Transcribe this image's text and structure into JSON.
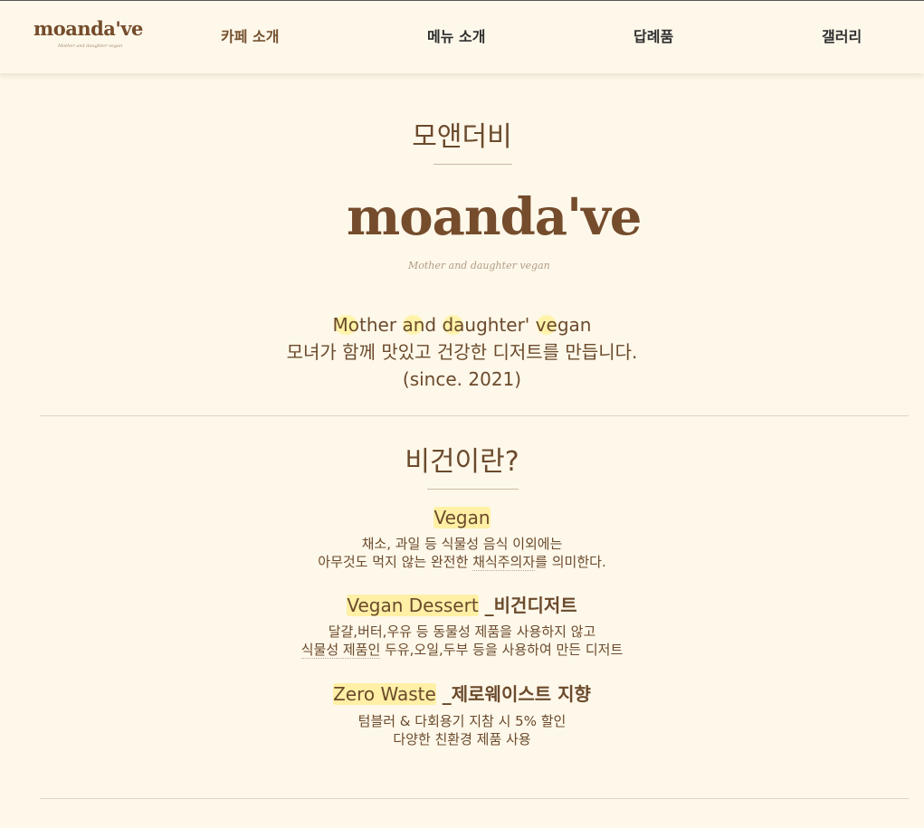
{
  "header": {
    "logo_text": "moanda've",
    "logo_subtitle": "Mother and daughter vegan",
    "nav": [
      {
        "label": "카페 소개"
      },
      {
        "label": "메뉴 소개"
      },
      {
        "label": "답례품"
      },
      {
        "label": "갤러리"
      }
    ]
  },
  "about": {
    "title": "모앤더비",
    "logo_text": "moanda've",
    "logo_subtitle": "Mother and daughter vegan",
    "tagline": {
      "parts": [
        {
          "text": "Mo",
          "hl": true
        },
        {
          "text": "ther ",
          "hl": false
        },
        {
          "text": "an",
          "hl": true
        },
        {
          "text": "d ",
          "hl": false
        },
        {
          "text": "da",
          "hl": true
        },
        {
          "text": "ughter' ",
          "hl": false
        },
        {
          "text": "ve",
          "hl": true
        },
        {
          "text": "gan",
          "hl": false
        }
      ]
    },
    "line2": "모녀가 함께 맛있고 건강한 디저트를 만듭니다.",
    "line3": "(since. 2021)"
  },
  "vegan": {
    "title": "비건이란?",
    "items": [
      {
        "heading_mark": "Vegan",
        "heading_rest": "",
        "line1": "채소, 과일 등 식물성 음식 이외에는",
        "line2_pre": "아무것도 먹지 않는 완전한 ",
        "line2_dotted": "채식주의자",
        "line2_post": "를 의미한다."
      },
      {
        "heading_mark": "Vegan Dessert",
        "heading_rest": " _비건디저트",
        "line1": "달걀,버터,우유 등 동물성 제품을 사용하지 않고",
        "line2_pre": "",
        "line2_dotted": "식물성 제품인",
        "line2_post": " 두유,오일,두부 등을 사용하여 만든 디저트"
      },
      {
        "heading_mark": "Zero Waste",
        "heading_rest": " _제로웨이스트 지향",
        "line1": "텀블러 & 다회용기 지참 시 5% 할인",
        "line2_pre": "다양한 친환경 제품 사용",
        "line2_dotted": "",
        "line2_post": ""
      }
    ]
  },
  "colors": {
    "background": "#fef8ea",
    "brand_brown": "#754c2c",
    "text_brown": "#6b4a2c",
    "highlight": "#fff0a6"
  }
}
